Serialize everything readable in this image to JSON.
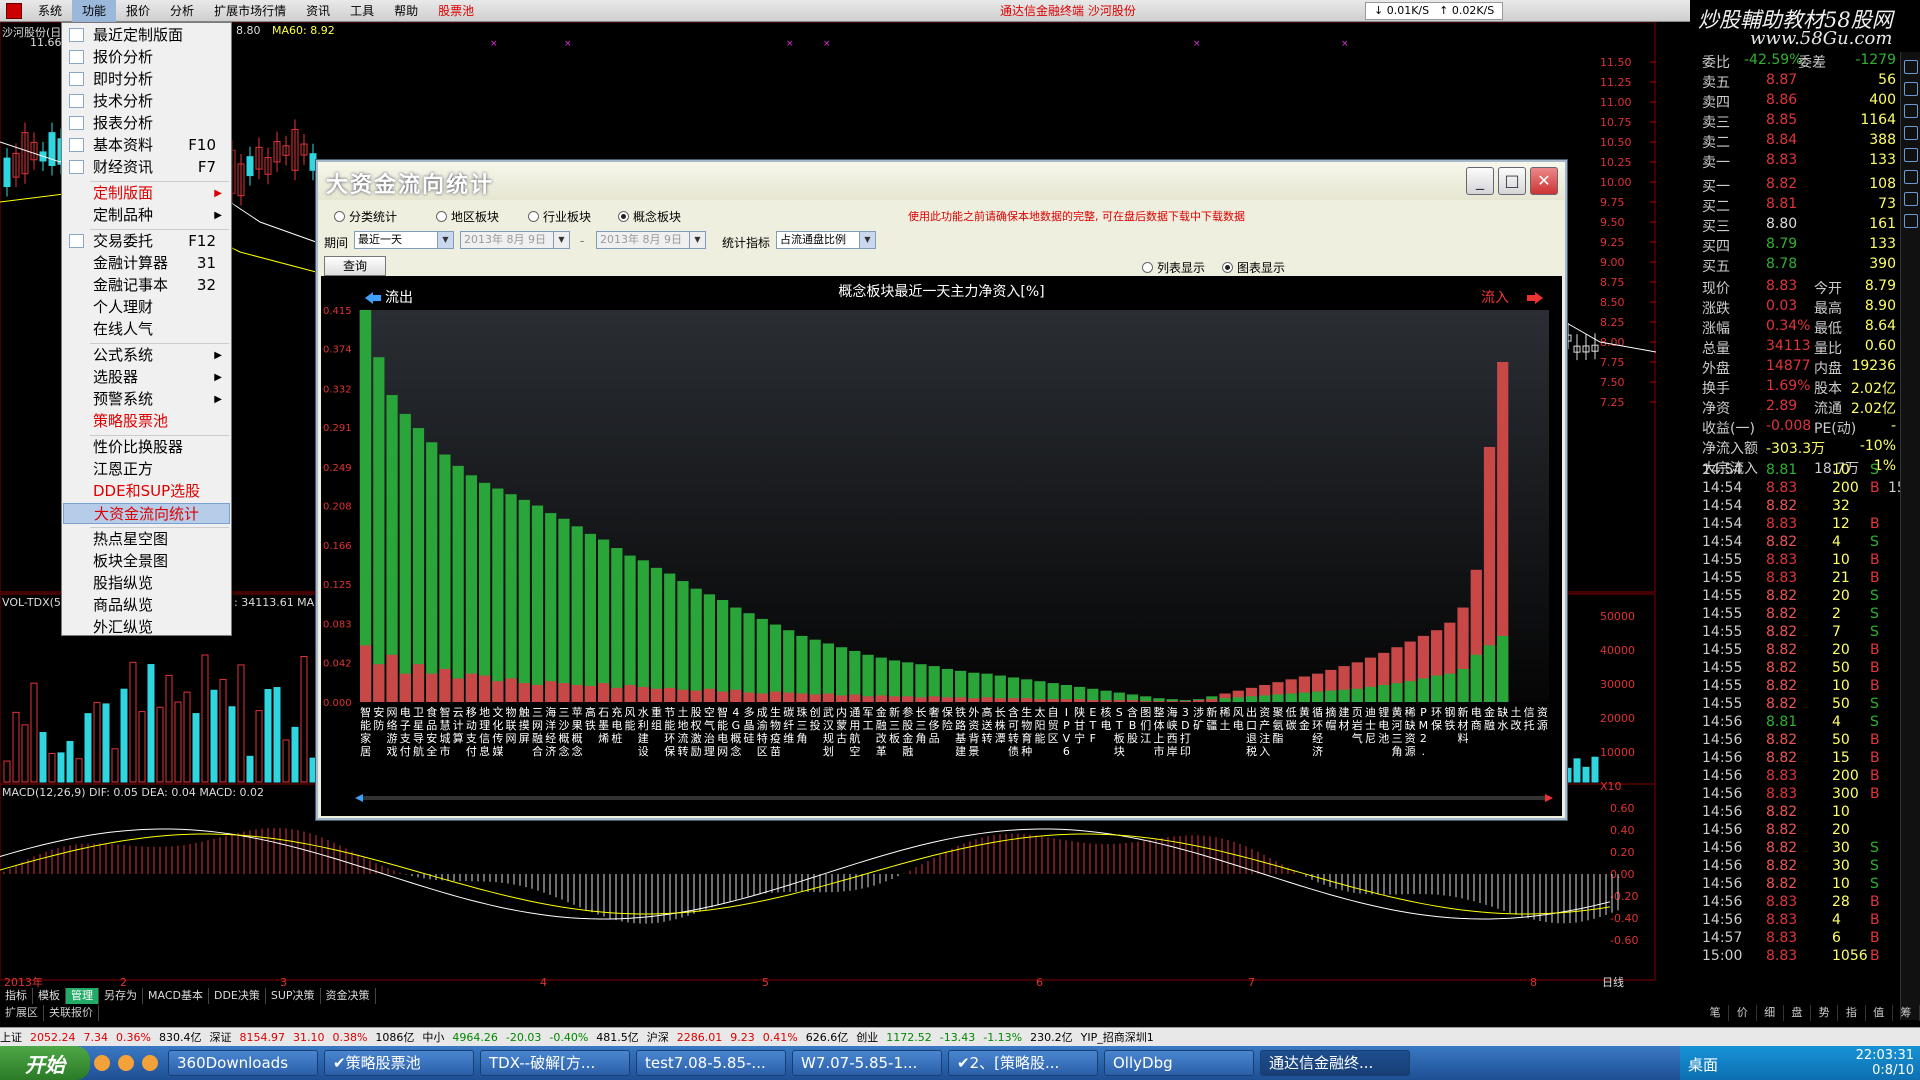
{
  "menubar": {
    "items": [
      "系统",
      "功能",
      "报价",
      "分析",
      "扩展市场行情",
      "资讯",
      "工具",
      "帮助",
      "股票池"
    ],
    "center_title": "通达信金融终端  沙河股份",
    "speed_down": "0.01K/S",
    "speed_up": "0.02K/S"
  },
  "watermark": {
    "line1": "炒股輔助教材58股网",
    "line2": "www.58Gu.com"
  },
  "chart": {
    "stock_label": "沙河股份(日",
    "ma60": "MA60: 8.92",
    "ma_val": "8.80",
    "price_top": "11.66",
    "vol_label": "VOL-TDX(5",
    "vol_val": ": 34113.61  MA",
    "macd_label": "MACD(12,26,9)  DIF: 0.05  DEA: 0.04  MACD: 0.02",
    "price_axis": [
      "11.50",
      "11.25",
      "11.00",
      "10.75",
      "10.50",
      "10.25",
      "10.00",
      "9.75",
      "9.50",
      "9.25",
      "9.00",
      "8.75",
      "8.50",
      "8.25",
      "8.00",
      "7.75",
      "7.50",
      "7.25"
    ],
    "vol_axis": [
      "50000",
      "40000",
      "30000",
      "20000",
      "10000",
      "X10"
    ],
    "macd_axis": [
      "0.60",
      "0.40",
      "0.20",
      "0.00",
      "-0.20",
      "-0.40",
      "-0.60"
    ],
    "months": [
      "2013年",
      "2",
      "3",
      "4",
      "5",
      "6",
      "7",
      "8"
    ],
    "right_label": "日线"
  },
  "menu": {
    "items": [
      {
        "label": "最近定制版面",
        "shortcut": "",
        "submenu": false,
        "style": ""
      },
      {
        "label": "报价分析",
        "shortcut": "",
        "submenu": false,
        "style": ""
      },
      {
        "label": "即时分析",
        "shortcut": "",
        "submenu": false,
        "style": ""
      },
      {
        "label": "技术分析",
        "shortcut": "",
        "submenu": false,
        "style": ""
      },
      {
        "label": "报表分析",
        "shortcut": "",
        "submenu": false,
        "style": ""
      },
      {
        "label": "基本资料",
        "shortcut": "F10",
        "submenu": false,
        "style": ""
      },
      {
        "label": "财经资讯",
        "shortcut": "F7",
        "submenu": false,
        "style": ""
      },
      {
        "label": "定制版面",
        "shortcut": "",
        "submenu": true,
        "style": "red"
      },
      {
        "label": "定制品种",
        "shortcut": "",
        "submenu": true,
        "style": ""
      },
      {
        "label": "交易委托",
        "shortcut": "F12",
        "submenu": false,
        "style": ""
      },
      {
        "label": "金融计算器",
        "shortcut": "31",
        "submenu": false,
        "style": ""
      },
      {
        "label": "金融记事本",
        "shortcut": "32",
        "submenu": false,
        "style": ""
      },
      {
        "label": "个人理财",
        "shortcut": "",
        "submenu": false,
        "style": ""
      },
      {
        "label": "在线人气",
        "shortcut": "",
        "submenu": false,
        "style": ""
      },
      {
        "label": "公式系统",
        "shortcut": "",
        "submenu": true,
        "style": ""
      },
      {
        "label": "选股器",
        "shortcut": "",
        "submenu": true,
        "style": ""
      },
      {
        "label": "预警系统",
        "shortcut": "",
        "submenu": true,
        "style": ""
      },
      {
        "label": "策略股票池",
        "shortcut": "",
        "submenu": false,
        "style": "red"
      },
      {
        "label": "性价比换股器",
        "shortcut": "",
        "submenu": false,
        "style": ""
      },
      {
        "label": "江恩正方",
        "shortcut": "",
        "submenu": false,
        "style": ""
      },
      {
        "label": "DDE和SUP选股",
        "shortcut": "",
        "submenu": false,
        "style": "red"
      },
      {
        "label": "大资金流向统计",
        "shortcut": "",
        "submenu": false,
        "style": "sel"
      },
      {
        "label": "热点星空图",
        "shortcut": "",
        "submenu": false,
        "style": ""
      },
      {
        "label": "板块全景图",
        "shortcut": "",
        "submenu": false,
        "style": ""
      },
      {
        "label": "股指纵览",
        "shortcut": "",
        "submenu": false,
        "style": ""
      },
      {
        "label": "商品纵览",
        "shortcut": "",
        "submenu": false,
        "style": ""
      },
      {
        "label": "外汇纵览",
        "shortcut": "",
        "submenu": false,
        "style": ""
      }
    ]
  },
  "dialog": {
    "title": "大资金流向统计",
    "radios": [
      "分类统计",
      "地区板块",
      "行业板块",
      "概念板块"
    ],
    "selected_radio": 3,
    "period_label": "期间",
    "period_value": "最近一天",
    "date_from": "2013年 8月 9日",
    "date_dash": "-",
    "date_to": "2013年 8月 9日",
    "metric_label": "统计指标",
    "metric_value": "占流通盘比例",
    "query_button": "查询",
    "warning": "使用此功能之前请确保本地数据的完整, 可在盘后数据下载中下载数据",
    "view_list": "列表显示",
    "view_chart": "图表显示",
    "chart_title": "概念板块最近一天主力净资入[%]",
    "outflow": "流出",
    "inflow": "流入"
  },
  "chart_data": {
    "type": "bar",
    "title": "概念板块最近一天主力净资入[%]",
    "ylim": [
      0,
      0.415
    ],
    "yticks": [
      "0.415",
      "0.374",
      "0.332",
      "0.291",
      "0.249",
      "0.208",
      "0.166",
      "0.125",
      "0.083",
      "0.042",
      "0.000"
    ],
    "categories": [
      "智能家居",
      "安防",
      "网络游戏",
      "电子支付",
      "卫星导航",
      "食品安全",
      "智慧城市",
      "云计算",
      "移动支付",
      "地理信息",
      "文化传媒",
      "物联网",
      "触摸屏",
      "三网融合",
      "海洋经济",
      "三沙概念",
      "苹果概念",
      "高铁",
      "石墨烯",
      "充电桩",
      "风能",
      "水利建设",
      "重组",
      "节能环保",
      "土地流转",
      "股权激励",
      "空气治理",
      "智能电网",
      "4G概念",
      "多晶硅",
      "成渝特区",
      "生物疫苗",
      "碳纤维",
      "珠三角",
      "创投",
      "武汉规划",
      "内蒙古",
      "通用航空",
      "军工",
      "金融改革",
      "新三板",
      "参股金融",
      "长三角",
      "奢侈品",
      "保险",
      "铁路基建",
      "外资背景",
      "高送转",
      "长株潭",
      "含可转债",
      "生物育种",
      "太阳能",
      "自贸区",
      "IPV6",
      "陕甘宁",
      "ETF",
      "核电",
      "ST板块",
      "含B股",
      "图们江",
      "整体上市",
      "海峡西岸",
      "3D打印",
      "涉矿",
      "新疆",
      "稀土",
      "风电",
      "出口退税",
      "资产注入",
      "聚氨酯",
      "低碳",
      "黄金",
      "循环经济",
      "摘帽",
      "建材",
      "页岩气",
      "迪士尼",
      "锂电池",
      "黄河三角",
      "稀缺资源",
      "PM2.5",
      "环保",
      "钢铁",
      "新材料",
      "电商",
      "金融",
      "缺水",
      "土改",
      "信托",
      "资源"
    ],
    "series": [
      {
        "values": [
          0.415,
          0.365,
          0.325,
          0.305,
          0.29,
          0.275,
          0.262,
          0.25,
          0.24,
          0.232,
          0.226,
          0.22,
          0.214,
          0.208,
          0.2,
          0.194,
          0.186,
          0.178,
          0.172,
          0.163,
          0.155,
          0.15,
          0.142,
          0.136,
          0.128,
          0.12,
          0.114,
          0.108,
          0.1,
          0.094,
          0.088,
          0.082,
          0.076,
          0.07,
          0.066,
          0.062,
          0.058,
          0.054,
          0.05,
          0.047,
          0.044,
          0.042,
          0.04,
          0.038,
          0.035,
          0.033,
          0.031,
          0.03,
          0.028,
          0.026,
          0.024,
          0.022,
          0.02,
          0.018,
          0.016,
          0.014,
          0.012,
          0.01,
          0.008,
          0.006,
          0.004,
          0.003,
          0.002,
          0.003,
          0.006,
          0.009,
          0.012,
          0.015,
          0.018,
          0.021,
          0.024,
          0.027,
          0.03,
          0.034,
          0.038,
          0.042,
          0.047,
          0.052,
          0.058,
          0.064,
          0.07,
          0.076,
          0.084,
          0.1,
          0.14,
          0.27,
          0.36
        ]
      },
      {
        "values": [
          0.06,
          0.04,
          0.05,
          0.03,
          0.04,
          0.03,
          0.035,
          0.025,
          0.03,
          0.028,
          0.022,
          0.025,
          0.02,
          0.018,
          0.022,
          0.02,
          0.018,
          0.017,
          0.02,
          0.015,
          0.018,
          0.016,
          0.014,
          0.015,
          0.013,
          0.012,
          0.014,
          0.011,
          0.013,
          0.01,
          0.009,
          0.011,
          0.01,
          0.009,
          0.008,
          0.009,
          0.007,
          0.008,
          0.006,
          0.007,
          0.006,
          0.006,
          0.005,
          0.006,
          0.005,
          0.005,
          0.004,
          0.005,
          0.004,
          0.004,
          0.004,
          0.003,
          0.003,
          0.003,
          0.003,
          0.002,
          0.002,
          0.002,
          0.002,
          0.001,
          0.001,
          0.001,
          0.001,
          0.002,
          0.003,
          0.004,
          0.005,
          0.006,
          0.007,
          0.008,
          0.009,
          0.01,
          0.011,
          0.012,
          0.013,
          0.014,
          0.016,
          0.018,
          0.02,
          0.022,
          0.025,
          0.028,
          0.03,
          0.035,
          0.05,
          0.06,
          0.07
        ]
      }
    ]
  },
  "quote": {
    "header": [
      "委比",
      "-42.59%",
      "委差",
      "-1279"
    ],
    "rows": [
      [
        "卖五",
        "8.87",
        "56"
      ],
      [
        "卖四",
        "8.86",
        "400"
      ],
      [
        "卖三",
        "8.85",
        "1164"
      ],
      [
        "卖二",
        "8.84",
        "388"
      ],
      [
        "卖一",
        "8.83",
        "133"
      ],
      [
        "买一",
        "8.82",
        "108"
      ],
      [
        "买二",
        "8.81",
        "73"
      ],
      [
        "买三",
        "8.80",
        "161"
      ],
      [
        "买四",
        "8.79",
        "133"
      ],
      [
        "买五",
        "8.78",
        "390"
      ]
    ],
    "stats": [
      [
        "现价",
        "8.83",
        "今开",
        "8.79"
      ],
      [
        "涨跌",
        "0.03",
        "最高",
        "8.90"
      ],
      [
        "涨幅",
        "0.34%",
        "最低",
        "8.64"
      ],
      [
        "总量",
        "34113",
        "量比",
        "0.60"
      ],
      [
        "外盘",
        "14877",
        "内盘",
        "19236"
      ],
      [
        "换手",
        "1.69%",
        "股本",
        "2.02亿"
      ],
      [
        "净资",
        "2.89",
        "流通",
        "2.02亿"
      ],
      [
        "收益(一)",
        "-0.008",
        "PE(动)",
        "-"
      ],
      [
        "净流入额",
        "-303.3万",
        "",
        "-10%"
      ],
      [
        "大宗流入",
        "",
        "18.7万",
        "1%"
      ]
    ],
    "ticks": [
      [
        "14:54",
        "8.81",
        "10",
        "S"
      ],
      [
        "14:54",
        "8.83",
        "200",
        "B",
        "15"
      ],
      [
        "14:54",
        "8.82",
        "32",
        ""
      ],
      [
        "14:54",
        "8.83",
        "12",
        "B"
      ],
      [
        "14:54",
        "8.82",
        "4",
        "S"
      ],
      [
        "14:55",
        "8.83",
        "10",
        "B"
      ],
      [
        "14:55",
        "8.83",
        "21",
        "B"
      ],
      [
        "14:55",
        "8.82",
        "20",
        "S"
      ],
      [
        "14:55",
        "8.82",
        "2",
        "S"
      ],
      [
        "14:55",
        "8.82",
        "7",
        "S"
      ],
      [
        "14:55",
        "8.82",
        "20",
        "B"
      ],
      [
        "14:55",
        "8.82",
        "50",
        "B"
      ],
      [
        "14:55",
        "8.82",
        "10",
        "B"
      ],
      [
        "14:55",
        "8.82",
        "50",
        "S"
      ],
      [
        "14:56",
        "8.81",
        "4",
        "S"
      ],
      [
        "14:56",
        "8.82",
        "50",
        "B"
      ],
      [
        "14:56",
        "8.82",
        "15",
        "B"
      ],
      [
        "14:56",
        "8.83",
        "200",
        "B"
      ],
      [
        "14:56",
        "8.83",
        "300",
        "B"
      ],
      [
        "14:56",
        "8.82",
        "10",
        ""
      ],
      [
        "14:56",
        "8.82",
        "20",
        ""
      ],
      [
        "14:56",
        "8.82",
        "30",
        "S"
      ],
      [
        "14:56",
        "8.82",
        "30",
        "S"
      ],
      [
        "14:56",
        "8.82",
        "10",
        "S"
      ],
      [
        "14:56",
        "8.83",
        "28",
        "B"
      ],
      [
        "14:56",
        "8.83",
        "4",
        "B"
      ],
      [
        "14:57",
        "8.83",
        "6",
        "B"
      ],
      [
        "15:00",
        "8.83",
        "1056",
        "B"
      ]
    ]
  },
  "tabbar": [
    "指标",
    "模板",
    "管理",
    "另存为",
    "MACD基本",
    "DDE决策",
    "SUP决策",
    "资金决策"
  ],
  "subbar": [
    "扩展区",
    "关联报价"
  ],
  "rtabs": [
    "笔",
    "价",
    "细",
    "盘",
    "势",
    "指",
    "值",
    "筹"
  ],
  "statusbar": {
    "items": [
      {
        "t": "上证",
        "c": ""
      },
      {
        "t": "2052.24",
        "c": "r"
      },
      {
        "t": "7.34",
        "c": "r"
      },
      {
        "t": "0.36%",
        "c": "r"
      },
      {
        "t": "830.4亿",
        "c": ""
      },
      {
        "t": "深证",
        "c": ""
      },
      {
        "t": "8154.97",
        "c": "r"
      },
      {
        "t": "31.10",
        "c": "r"
      },
      {
        "t": "0.38%",
        "c": "r"
      },
      {
        "t": "1086亿",
        "c": ""
      },
      {
        "t": "中小",
        "c": ""
      },
      {
        "t": "4964.26",
        "c": "gr"
      },
      {
        "t": "-20.03",
        "c": "gr"
      },
      {
        "t": "-0.40%",
        "c": "gr"
      },
      {
        "t": "481.5亿",
        "c": ""
      },
      {
        "t": "沪深",
        "c": ""
      },
      {
        "t": "2286.01",
        "c": "r"
      },
      {
        "t": "9.23",
        "c": "r"
      },
      {
        "t": "0.41%",
        "c": "r"
      },
      {
        "t": "626.6亿",
        "c": ""
      },
      {
        "t": "创业",
        "c": ""
      },
      {
        "t": "1172.52",
        "c": "gr"
      },
      {
        "t": "-13.43",
        "c": "gr"
      },
      {
        "t": "-1.13%",
        "c": "gr"
      },
      {
        "t": "230.2亿",
        "c": ""
      },
      {
        "t": "YIP_招商深圳1",
        "c": ""
      }
    ]
  },
  "taskbar": {
    "start": "开始",
    "buttons": [
      "360Downloads",
      "✔策略股票池",
      "TDX--破解[方...",
      "test7.08-5.85-...",
      "W7.07-5.85-1...",
      "✔2、[策略股...",
      "OllyDbg",
      "通达信金融终..."
    ],
    "desktop": "桌面",
    "time": "22:03:31",
    "date": "0:8/10"
  },
  "colors": {
    "up": "#e0353a",
    "down": "#2fb12f",
    "cyan": "#2fd6e0",
    "menu_sel": "#b6cde9"
  }
}
